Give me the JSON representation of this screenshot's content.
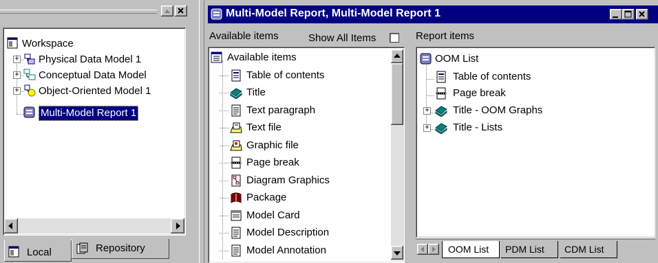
{
  "left_panel": {
    "tree": [
      {
        "label": "Workspace",
        "icon": "workspace-icon"
      },
      {
        "label": "Physical Data Model 1",
        "icon": "physical-model-icon"
      },
      {
        "label": "Conceptual Data Model",
        "icon": "conceptual-model-icon"
      },
      {
        "label": "Object-Oriented Model 1",
        "icon": "oo-model-icon"
      },
      {
        "label": "Multi-Model Report 1",
        "icon": "report-icon",
        "selected": true
      }
    ],
    "tabs": [
      {
        "label": "Local",
        "icon": "local-icon"
      },
      {
        "label": "Repository",
        "icon": "repository-icon"
      }
    ]
  },
  "window": {
    "title": "Multi-Model Report, Multi-Model Report 1",
    "title_color": "#000080"
  },
  "available": {
    "header_label": "Available items",
    "show_all_label": "Show All Items",
    "items": [
      {
        "label": "Available items",
        "icon": "list-icon"
      },
      {
        "label": "Table of contents",
        "icon": "toc-icon"
      },
      {
        "label": "Title",
        "icon": "book-icon"
      },
      {
        "label": "Text paragraph",
        "icon": "document-icon"
      },
      {
        "label": "Text file",
        "icon": "text-file-icon"
      },
      {
        "label": "Graphic file",
        "icon": "graphic-file-icon"
      },
      {
        "label": "Page break",
        "icon": "page-break-icon"
      },
      {
        "label": "Diagram Graphics",
        "icon": "diagram-icon"
      },
      {
        "label": "Package",
        "icon": "package-icon"
      },
      {
        "label": "Model Card",
        "icon": "card-icon"
      },
      {
        "label": "Model Description",
        "icon": "document-icon"
      },
      {
        "label": "Model Annotation",
        "icon": "document-icon"
      }
    ]
  },
  "report": {
    "header_label": "Report items",
    "items": [
      {
        "label": "OOM List",
        "icon": "report-icon"
      },
      {
        "label": "Table of contents",
        "icon": "toc-icon"
      },
      {
        "label": "Page break",
        "icon": "page-break-icon"
      },
      {
        "label": "Title - OOM Graphs",
        "icon": "book-icon"
      },
      {
        "label": "Title - Lists",
        "icon": "book-icon"
      }
    ],
    "tabs": [
      "OOM List",
      "PDM List",
      "CDM List"
    ]
  }
}
